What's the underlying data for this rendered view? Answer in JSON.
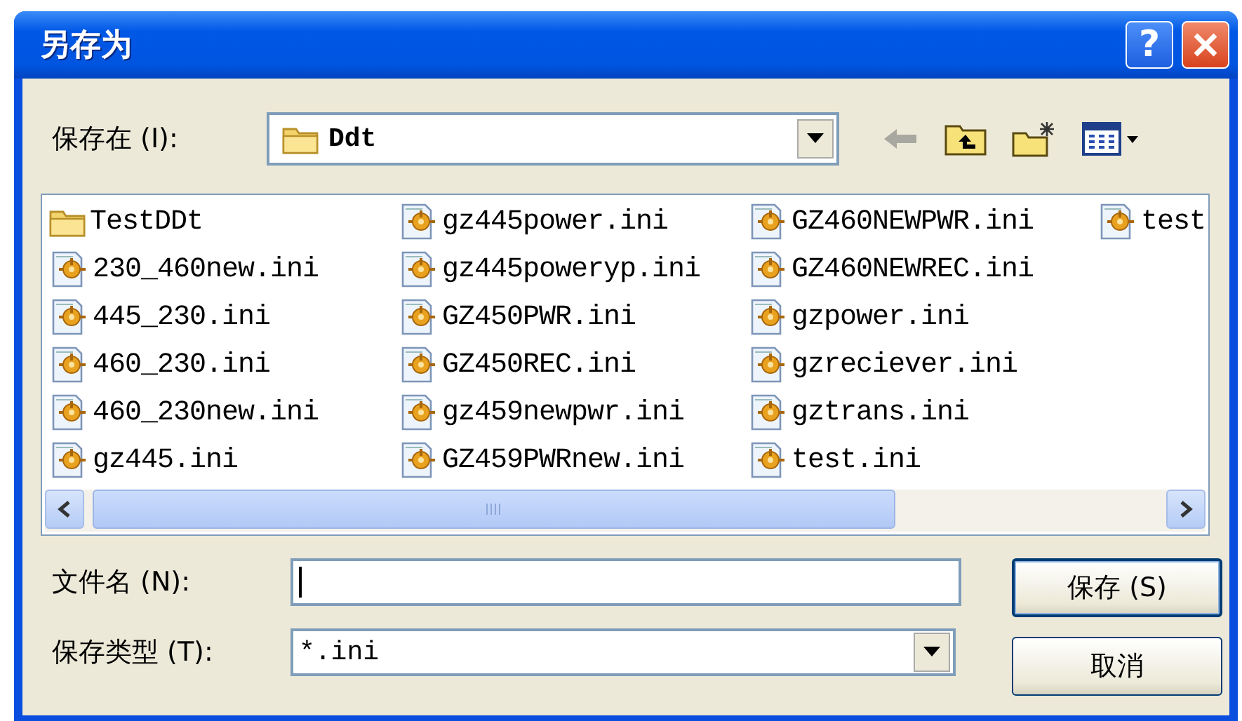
{
  "window": {
    "title": "另存为",
    "help_button": "?"
  },
  "save_in": {
    "label": "保存在 (I):",
    "value": "Ddt"
  },
  "files": [
    {
      "name": "TestDDt",
      "kind": "folder"
    },
    {
      "name": "230_460new.ini",
      "kind": "ini"
    },
    {
      "name": "445_230.ini",
      "kind": "ini"
    },
    {
      "name": "460_230.ini",
      "kind": "ini"
    },
    {
      "name": "460_230new.ini",
      "kind": "ini"
    },
    {
      "name": "gz445.ini",
      "kind": "ini"
    },
    {
      "name": "gz445power.ini",
      "kind": "ini"
    },
    {
      "name": "gz445poweryp.ini",
      "kind": "ini"
    },
    {
      "name": "GZ450PWR.ini",
      "kind": "ini"
    },
    {
      "name": "GZ450REC.ini",
      "kind": "ini"
    },
    {
      "name": "gz459newpwr.ini",
      "kind": "ini"
    },
    {
      "name": "GZ459PWRnew.ini",
      "kind": "ini"
    },
    {
      "name": "GZ460NEWPWR.ini",
      "kind": "ini"
    },
    {
      "name": "GZ460NEWREC.ini",
      "kind": "ini"
    },
    {
      "name": "gzpower.ini",
      "kind": "ini"
    },
    {
      "name": "gzreciever.ini",
      "kind": "ini"
    },
    {
      "name": "gztrans.ini",
      "kind": "ini"
    },
    {
      "name": "test.ini",
      "kind": "ini"
    },
    {
      "name": "test",
      "kind": "ini"
    }
  ],
  "file_name": {
    "label": "文件名 (N):"
  },
  "file_type": {
    "label": "保存类型 (T):",
    "value": "*.ini"
  },
  "buttons": [
    {
      "label": "保存 (S)",
      "default": true
    },
    {
      "label": "取消",
      "default": false
    }
  ]
}
